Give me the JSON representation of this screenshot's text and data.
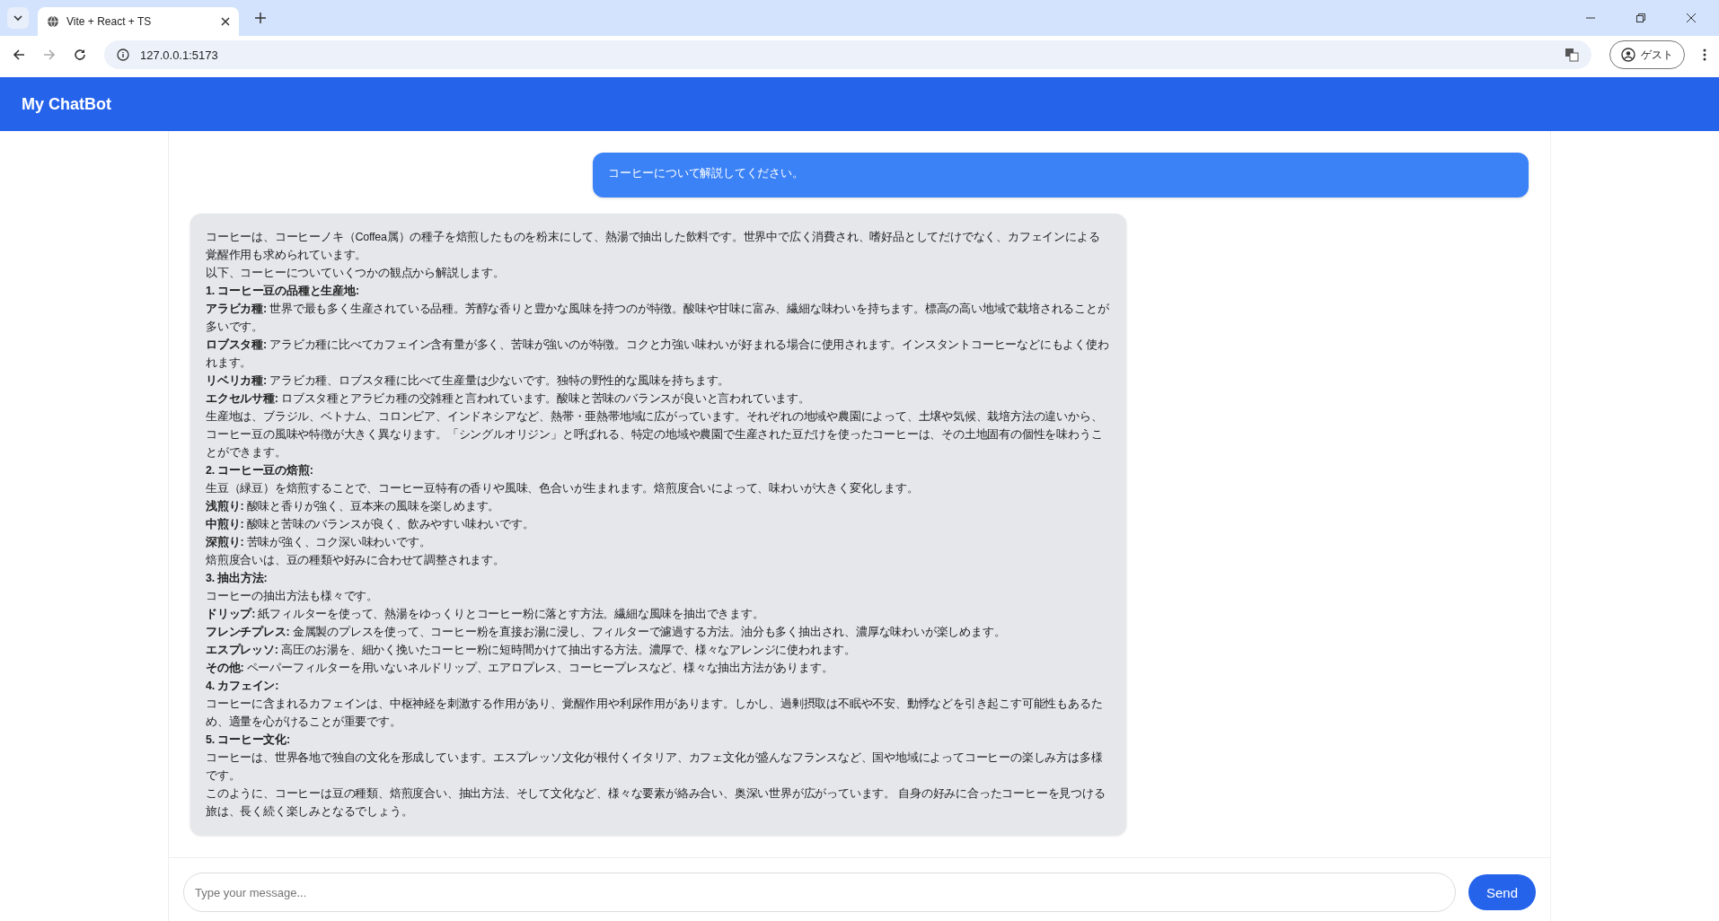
{
  "browser": {
    "tab_title": "Vite + React + TS",
    "url": "127.0.0.1:5173",
    "profile": "ゲスト"
  },
  "header": {
    "title": "My ChatBot"
  },
  "messages": [
    {
      "kind": "user",
      "lines": [
        {
          "kind": "text",
          "text": "コーヒーについて解説してください。"
        }
      ]
    },
    {
      "kind": "bot",
      "lines": [
        {
          "kind": "text",
          "text": "コーヒーは、コーヒーノキ（Coffea属）の種子を焙煎したものを粉末にして、熱湯で抽出した飲料です。世界中で広く消費され、嗜好品としてだけでなく、カフェインによる覚醒作用も求められています。"
        },
        {
          "kind": "text",
          "text": "以下、コーヒーについていくつかの観点から解説します。"
        },
        {
          "kind": "heading",
          "text": "1. コーヒー豆の品種と生産地:"
        },
        {
          "kind": "text",
          "text": "**アラビカ種:** 世界で最も多く生産されている品種。芳醇な香りと豊かな風味を持つのが特徴。酸味や甘味に富み、繊細な味わいを持ちます。標高の高い地域で栽培されることが多いです。"
        },
        {
          "kind": "text",
          "text": "**ロブスタ種:** アラビカ種に比べてカフェイン含有量が多く、苦味が強いのが特徴。コクと力強い味わいが好まれる場合に使用されます。インスタントコーヒーなどにもよく使われます。"
        },
        {
          "kind": "text",
          "text": "**リベリカ種:** アラビカ種、ロブスタ種に比べて生産量は少ないです。独特の野性的な風味を持ちます。"
        },
        {
          "kind": "text",
          "text": "**エクセルサ種:** ロブスタ種とアラビカ種の交雑種と言われています。酸味と苦味のバランスが良いと言われています。"
        },
        {
          "kind": "text",
          "text": "生産地は、ブラジル、ベトナム、コロンビア、インドネシアなど、熱帯・亜熱帯地域に広がっています。それぞれの地域や農園によって、土壌や気候、栽培方法の違いから、コーヒー豆の風味や特徴が大きく異なります。「シングルオリジン」と呼ばれる、特定の地域や農園で生産された豆だけを使ったコーヒーは、その土地固有の個性を味わうことができます。"
        },
        {
          "kind": "heading",
          "text": "2. コーヒー豆の焙煎:"
        },
        {
          "kind": "text",
          "text": "生豆（緑豆）を焙煎することで、コーヒー豆特有の香りや風味、色合いが生まれます。焙煎度合いによって、味わいが大きく変化します。"
        },
        {
          "kind": "text",
          "text": "**浅煎り:** 酸味と香りが強く、豆本来の風味を楽しめます。"
        },
        {
          "kind": "text",
          "text": "**中煎り:** 酸味と苦味のバランスが良く、飲みやすい味わいです。"
        },
        {
          "kind": "text",
          "text": "**深煎り:** 苦味が強く、コク深い味わいです。"
        },
        {
          "kind": "text",
          "text": "焙煎度合いは、豆の種類や好みに合わせて調整されます。"
        },
        {
          "kind": "heading",
          "text": "3. 抽出方法:"
        },
        {
          "kind": "text",
          "text": "コーヒーの抽出方法も様々です。"
        },
        {
          "kind": "text",
          "text": "**ドリップ:** 紙フィルターを使って、熱湯をゆっくりとコーヒー粉に落とす方法。繊細な風味を抽出できます。"
        },
        {
          "kind": "text",
          "text": "**フレンチプレス:** 金属製のプレスを使って、コーヒー粉を直接お湯に浸し、フィルターで濾過する方法。油分も多く抽出され、濃厚な味わいが楽しめます。"
        },
        {
          "kind": "text",
          "text": "**エスプレッソ:** 高圧のお湯を、細かく挽いたコーヒー粉に短時間かけて抽出する方法。濃厚で、様々なアレンジに使われます。"
        },
        {
          "kind": "text",
          "text": "**その他:** ペーパーフィルターを用いないネルドリップ、エアロプレス、コーヒープレスなど、様々な抽出方法があります。"
        },
        {
          "kind": "heading",
          "text": "4. カフェイン:"
        },
        {
          "kind": "text",
          "text": "コーヒーに含まれるカフェインは、中枢神経を刺激する作用があり、覚醒作用や利尿作用があります。しかし、過剰摂取は不眠や不安、動悸などを引き起こす可能性もあるため、適量を心がけることが重要です。"
        },
        {
          "kind": "heading",
          "text": "5. コーヒー文化:"
        },
        {
          "kind": "text",
          "text": "コーヒーは、世界各地で独自の文化を形成しています。エスプレッソ文化が根付くイタリア、カフェ文化が盛んなフランスなど、国や地域によってコーヒーの楽しみ方は多様です。"
        },
        {
          "kind": "text",
          "text": "このように、コーヒーは豆の種類、焙煎度合い、抽出方法、そして文化など、様々な要素が絡み合い、奥深い世界が広がっています。 自身の好みに合ったコーヒーを見つける旅は、長く続く楽しみとなるでしょう。"
        }
      ]
    }
  ],
  "composer": {
    "placeholder": "Type your message...",
    "send_label": "Send"
  }
}
